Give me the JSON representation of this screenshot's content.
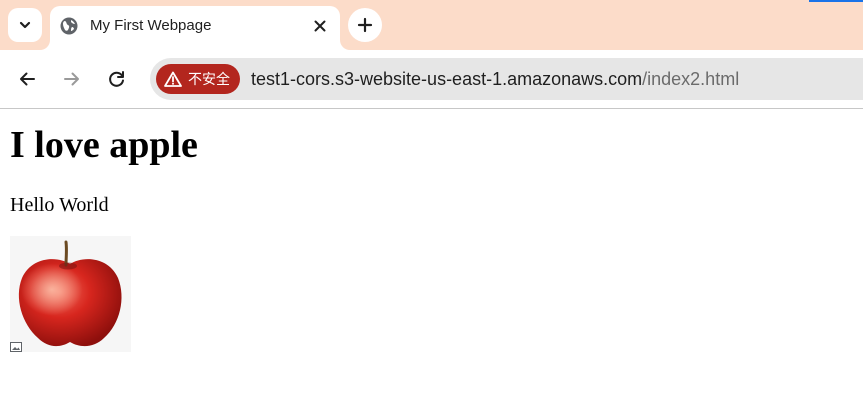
{
  "browser": {
    "tab": {
      "title": "My First Webpage",
      "favicon": "globe-icon"
    },
    "tab_strip_color": "#fcdcc9",
    "toolbar": {
      "back_icon": "back-arrow-icon",
      "forward_icon": "forward-arrow-icon",
      "reload_icon": "reload-icon"
    },
    "omnibox": {
      "security_label": "不安全",
      "security_icon": "warning-triangle-icon",
      "security_color": "#b3261e",
      "url_host": "test1-cors.s3-website-us-east-1.amazonaws.com",
      "url_path": "/index2.html"
    }
  },
  "page": {
    "heading": "I love apple",
    "paragraph": "Hello World",
    "image": {
      "subject": "red apple",
      "badge_icon": "broken-image-icon"
    }
  }
}
